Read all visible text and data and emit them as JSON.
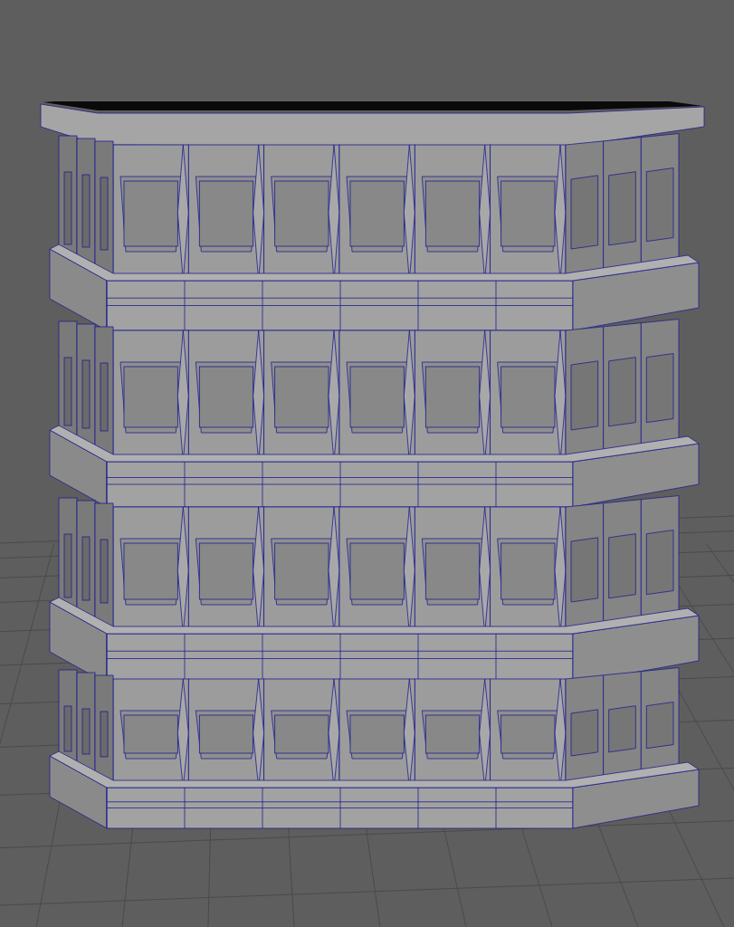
{
  "viewport": {
    "grid_visible": true,
    "wireframe_overlay": true
  }
}
